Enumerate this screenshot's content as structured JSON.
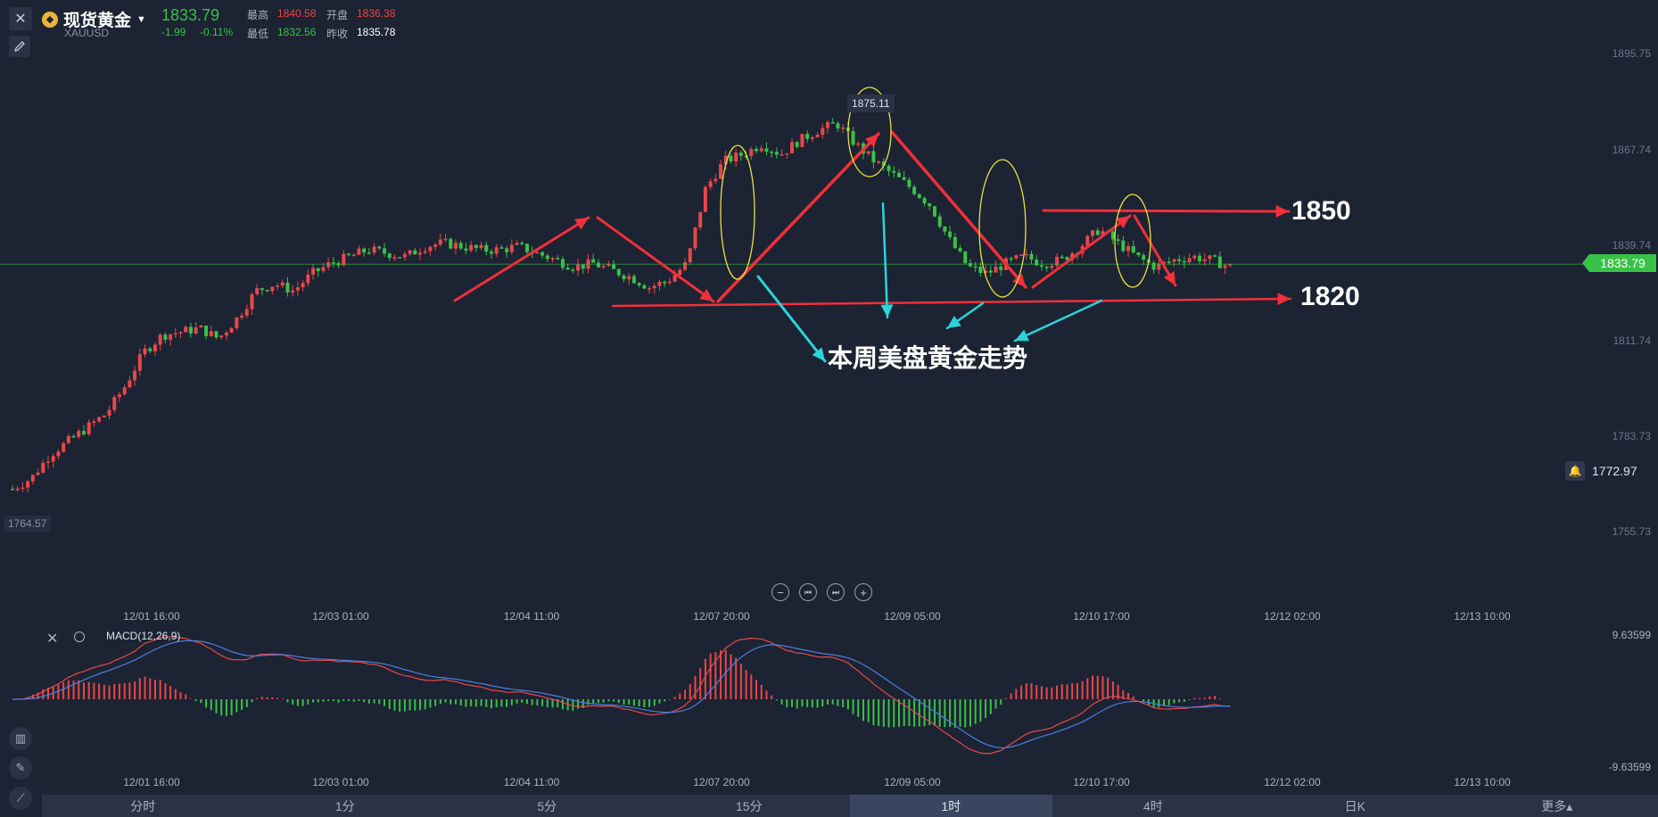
{
  "header": {
    "close_glyph": "✕",
    "symbol_name": "现货黄金",
    "symbol_code": "XAUUSD",
    "price": "1833.79",
    "change": "-1.99",
    "change_pct": "-0.11%",
    "high_label": "最高",
    "high_value": "1840.58",
    "open_label": "开盘",
    "open_value": "1836.38",
    "low_label": "最低",
    "low_value": "1832.56",
    "prev_label": "昨收",
    "prev_value": "1835.78"
  },
  "y_axis": [
    "1895.75",
    "1867.74",
    "1839.74",
    "1811.74",
    "1783.73",
    "1755.73"
  ],
  "current_price_tag": "1833.79",
  "alert_value": "1772.97",
  "min_label": "1764.57",
  "max_label": "1875.11",
  "x_axis": [
    "12/01 16:00",
    "12/03 01:00",
    "12/04 11:00",
    "12/07 20:00",
    "12/09 05:00",
    "12/10 17:00",
    "12/12 02:00",
    "12/13 10:00"
  ],
  "macd": {
    "label": "MACD(12,26,9)",
    "top": "9.63599",
    "bottom": "-9.63599"
  },
  "annotations": {
    "resistance": "1850",
    "support": "1820",
    "caption": "本周美盘黄金走势"
  },
  "tabs": [
    "分时",
    "1分",
    "5分",
    "15分",
    "1时",
    "4时",
    "日K",
    "更多▴"
  ],
  "active_tab": "1时",
  "colors": {
    "up": "#e8474a",
    "down": "#39c148",
    "background": "#1c2333",
    "annotation_red": "#f0303a",
    "annotation_cyan": "#2ad4d8",
    "ellipse": "#e6e23a"
  },
  "chart_data": {
    "type": "candlestick",
    "title": "现货黄金 XAUUSD",
    "ylim": [
      1750,
      1900
    ],
    "x_ticks": [
      "12/01 16:00",
      "12/03 01:00",
      "12/04 11:00",
      "12/07 20:00",
      "12/09 05:00",
      "12/10 17:00",
      "12/12 02:00",
      "12/13 10:00"
    ],
    "close_path": [
      1768,
      1771,
      1778,
      1782,
      1786,
      1790,
      1798,
      1808,
      1813,
      1814,
      1815,
      1812,
      1818,
      1826,
      1828,
      1826,
      1831,
      1834,
      1836,
      1838,
      1837,
      1836,
      1839,
      1840,
      1839,
      1838,
      1838,
      1839,
      1837,
      1835,
      1833,
      1834,
      1832,
      1830,
      1827,
      1829,
      1834,
      1856,
      1864,
      1866,
      1869,
      1866,
      1870,
      1873,
      1875,
      1869,
      1864,
      1860,
      1856,
      1851,
      1841,
      1833,
      1831,
      1834,
      1836,
      1834,
      1835,
      1839,
      1844,
      1840,
      1836,
      1833,
      1835,
      1836,
      1835,
      1833
    ],
    "high": 1840.58,
    "low": 1832.56,
    "open": 1836.38,
    "last": 1833.79,
    "prev_close": 1835.78,
    "marked_high": 1875.11,
    "marked_low": 1764.57,
    "levels": [
      1850,
      1820
    ],
    "macd_range": [
      -9.63599,
      9.63599
    ]
  }
}
